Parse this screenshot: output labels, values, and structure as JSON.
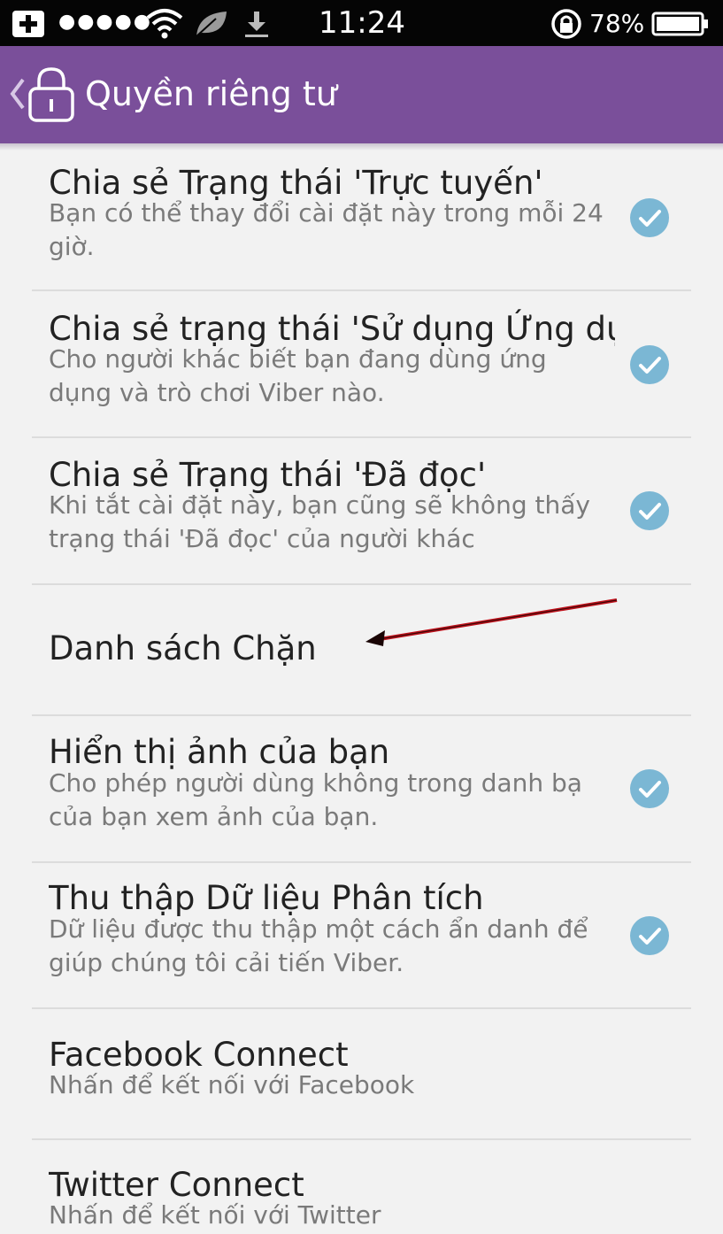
{
  "status_bar": {
    "signal_dots": "●●●●●",
    "time": "11:24",
    "battery_percent": "78%"
  },
  "app_bar": {
    "title": "Quyền riêng tư",
    "color": "#7a4f9a"
  },
  "items": [
    {
      "title": "Chia sẻ Trạng thái 'Trực tuyến'",
      "subtitle": "Bạn có thể thay đổi cài đặt này trong mỗi 24 giờ.",
      "checked": true
    },
    {
      "title": "Chia sẻ trạng thái 'Sử dụng Ứng dụng'",
      "subtitle": "Cho người khác biết bạn đang dùng ứng dụng và trò chơi Viber nào.",
      "checked": true
    },
    {
      "title": "Chia sẻ Trạng thái 'Đã đọc'",
      "subtitle": "Khi tắt cài đặt này, bạn cũng sẽ không thấy trạng thái 'Đã đọc' của người khác",
      "checked": true
    },
    {
      "title": "Danh sách Chặn",
      "subtitle": "",
      "checked": false
    },
    {
      "title": "Hiển thị ảnh của bạn",
      "subtitle": "Cho phép người dùng không trong danh bạ của bạn xem ảnh của bạn.",
      "checked": true
    },
    {
      "title": "Thu thập Dữ liệu Phân tích",
      "subtitle": "Dữ liệu được thu thập một cách ẩn danh để giúp chúng tôi cải tiến Viber.",
      "checked": true
    },
    {
      "title": "Facebook Connect",
      "subtitle": "Nhấn để kết nối với Facebook",
      "checked": false
    },
    {
      "title": "Twitter Connect",
      "subtitle": "Nhấn để kết nối với Twitter",
      "checked": false
    }
  ],
  "check_color": "#7bb7d4",
  "annotation_arrow_color": "#c0101a"
}
